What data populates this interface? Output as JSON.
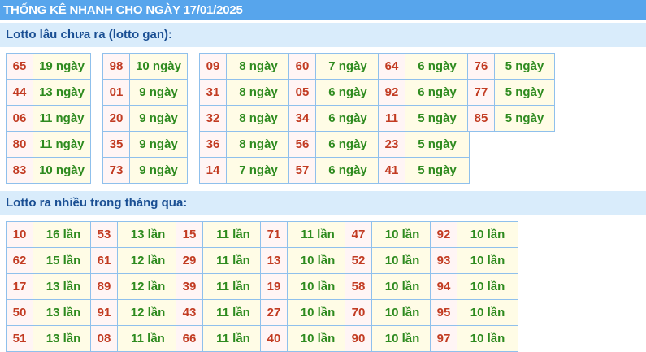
{
  "page_title": "THỐNG KÊ NHANH CHO NGÀY 17/01/2025",
  "sections": [
    {
      "heading": "Lotto lâu chưa ra (lotto gan):",
      "groups": [
        {
          "rows": [
            {
              "num": "65",
              "val": "19 ngày"
            },
            {
              "num": "44",
              "val": "13 ngày"
            },
            {
              "num": "06",
              "val": "11 ngày"
            },
            {
              "num": "80",
              "val": "11 ngày"
            },
            {
              "num": "83",
              "val": "10 ngày"
            }
          ]
        },
        {
          "rows": [
            {
              "num": "98",
              "val": "10 ngày"
            },
            {
              "num": "01",
              "val": "9 ngày"
            },
            {
              "num": "20",
              "val": "9 ngày"
            },
            {
              "num": "35",
              "val": "9 ngày"
            },
            {
              "num": "73",
              "val": "9 ngày"
            }
          ]
        },
        {
          "rows": [
            {
              "num": "09",
              "val": "8 ngày"
            },
            {
              "num": "31",
              "val": "8 ngày"
            },
            {
              "num": "32",
              "val": "8 ngày"
            },
            {
              "num": "36",
              "val": "8 ngày"
            },
            {
              "num": "14",
              "val": "7 ngày"
            }
          ]
        },
        {
          "rows": [
            {
              "num": "60",
              "val": "7 ngày"
            },
            {
              "num": "05",
              "val": "6 ngày"
            },
            {
              "num": "34",
              "val": "6 ngày"
            },
            {
              "num": "56",
              "val": "6 ngày"
            },
            {
              "num": "57",
              "val": "6 ngày"
            }
          ]
        },
        {
          "rows": [
            {
              "num": "64",
              "val": "6 ngày"
            },
            {
              "num": "92",
              "val": "6 ngày"
            },
            {
              "num": "11",
              "val": "5 ngày"
            },
            {
              "num": "23",
              "val": "5 ngày"
            },
            {
              "num": "41",
              "val": "5 ngày"
            }
          ]
        },
        {
          "rows": [
            {
              "num": "76",
              "val": "5 ngày"
            },
            {
              "num": "77",
              "val": "5 ngày"
            },
            {
              "num": "85",
              "val": "5 ngày"
            }
          ]
        }
      ]
    },
    {
      "heading": "Lotto ra nhiều trong tháng qua:",
      "groups": [
        {
          "rows": [
            {
              "num": "10",
              "val": "16 lần"
            },
            {
              "num": "62",
              "val": "15 lần"
            },
            {
              "num": "17",
              "val": "13 lần"
            },
            {
              "num": "50",
              "val": "13 lần"
            },
            {
              "num": "51",
              "val": "13 lần"
            }
          ]
        },
        {
          "rows": [
            {
              "num": "53",
              "val": "13 lần"
            },
            {
              "num": "61",
              "val": "12 lần"
            },
            {
              "num": "89",
              "val": "12 lần"
            },
            {
              "num": "91",
              "val": "12 lần"
            },
            {
              "num": "08",
              "val": "11 lần"
            }
          ]
        },
        {
          "rows": [
            {
              "num": "15",
              "val": "11 lần"
            },
            {
              "num": "29",
              "val": "11 lần"
            },
            {
              "num": "39",
              "val": "11 lần"
            },
            {
              "num": "43",
              "val": "11 lần"
            },
            {
              "num": "66",
              "val": "11 lần"
            }
          ]
        },
        {
          "rows": [
            {
              "num": "71",
              "val": "11 lần"
            },
            {
              "num": "13",
              "val": "10 lần"
            },
            {
              "num": "19",
              "val": "10 lần"
            },
            {
              "num": "27",
              "val": "10 lần"
            },
            {
              "num": "40",
              "val": "10 lần"
            }
          ]
        },
        {
          "rows": [
            {
              "num": "47",
              "val": "10 lần"
            },
            {
              "num": "52",
              "val": "10 lần"
            },
            {
              "num": "58",
              "val": "10 lần"
            },
            {
              "num": "70",
              "val": "10 lần"
            },
            {
              "num": "90",
              "val": "10 lần"
            }
          ]
        },
        {
          "rows": [
            {
              "num": "92",
              "val": "10 lần"
            },
            {
              "num": "93",
              "val": "10 lần"
            },
            {
              "num": "94",
              "val": "10 lần"
            },
            {
              "num": "95",
              "val": "10 lần"
            },
            {
              "num": "97",
              "val": "10 lần"
            }
          ]
        }
      ]
    }
  ],
  "colors": {
    "title_bar_bg": "#57a5ec",
    "section_head_bg": "#d9ecfb",
    "section_head_text": "#1a4f93",
    "number_text": "#c23b22",
    "value_text": "#2e8b1f",
    "cell_border": "#8fc0ec"
  }
}
